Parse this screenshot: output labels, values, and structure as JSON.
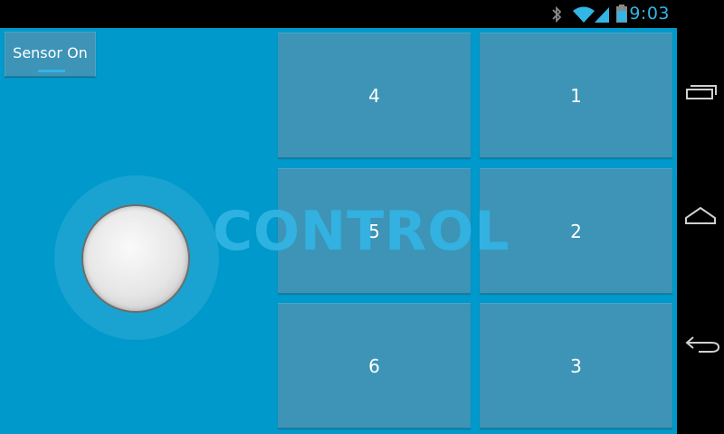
{
  "status_bar": {
    "time": "9:03",
    "icons": [
      "bluetooth-icon",
      "wifi-icon",
      "signal-icon",
      "battery-icon"
    ],
    "accent_color": "#33b5e5"
  },
  "app": {
    "background_color": "#0099cc",
    "sensor_toggle": {
      "label": "Sensor On",
      "state": "on"
    },
    "watermark": "CONTROL",
    "pads": [
      {
        "label": "4"
      },
      {
        "label": "1"
      },
      {
        "label": "5"
      },
      {
        "label": "2"
      },
      {
        "label": "6"
      },
      {
        "label": "3"
      }
    ]
  },
  "nav_bar": {
    "buttons": [
      "recent-apps-icon",
      "home-icon",
      "back-icon"
    ]
  }
}
